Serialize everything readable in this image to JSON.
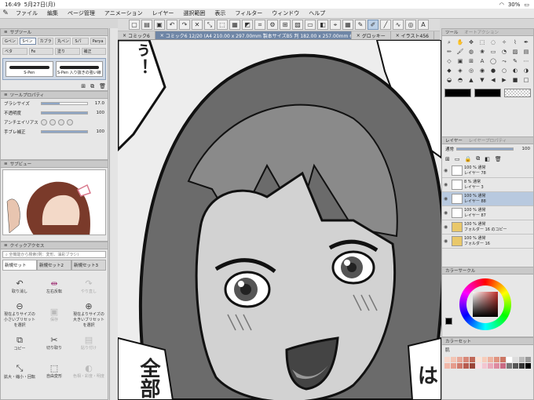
{
  "status": {
    "time": "16:49",
    "date": "5月27日(月)",
    "battery": "30%"
  },
  "menu": {
    "items": [
      "ファイル",
      "編集",
      "ページ管理",
      "アニメーション",
      "レイヤー",
      "選択範囲",
      "表示",
      "フィルター",
      "ウィンドウ",
      "ヘルプ"
    ]
  },
  "tabs": [
    {
      "label": "コミック6"
    },
    {
      "label": "コミック6 12/20 (A4 210.00 x 297.00mm 製本サイズB5 判 182.00 x 257.00mm 600dpi 119.9%)"
    },
    {
      "label": "グロッキー"
    },
    {
      "label": "イラスト456"
    }
  ],
  "subtool": {
    "title": "サブツール",
    "brushes": [
      "Gペン",
      "Sペン",
      "カブラ",
      "丸ペン",
      "Sパ",
      "Parya",
      "べタ",
      "Fe",
      "塗り",
      "補正"
    ],
    "selected_a": "S-Pen",
    "selected_b": "S-Pen 入り抜きの強い線"
  },
  "toolprop": {
    "title": "ツールプロパティ",
    "rows": [
      {
        "label": "ブラシサイズ",
        "value": "17.0"
      },
      {
        "label": "不透明度",
        "value": "100"
      },
      {
        "label": "アンチエイリアス",
        "value": ""
      },
      {
        "label": "手ブレ補正",
        "value": "100"
      }
    ]
  },
  "subview": {
    "title": "サブビュー"
  },
  "quick": {
    "title": "クイックアクセス",
    "search": "全機能から検索(例：変形、油彩ブラシ)",
    "tabs": [
      "新規セット",
      "新規セット2",
      "新規セット3"
    ],
    "cells": [
      {
        "label": "取り消し",
        "icon": "↶"
      },
      {
        "label": "左右反転",
        "icon": "⇹"
      },
      {
        "label": "やり直し",
        "icon": "↷"
      },
      {
        "label": "現在よりサイズの小さいブリセットを選択",
        "icon": "⊖"
      },
      {
        "label": "保存",
        "icon": "▣"
      },
      {
        "label": "現在よりサイズの大きいブリセットを選択",
        "icon": "⊕"
      },
      {
        "label": "コピー",
        "icon": "⧉"
      },
      {
        "label": "切り取り",
        "icon": "✂"
      },
      {
        "label": "貼り付け",
        "icon": "▤"
      },
      {
        "label": "拡大・縮小・回転",
        "icon": "⤡"
      },
      {
        "label": "自由変形",
        "icon": "⬚"
      },
      {
        "label": "色相・彩度・明度",
        "icon": "◐"
      }
    ]
  },
  "tools_panel": {
    "title": "ツール",
    "sub": "オートアクション"
  },
  "layers": {
    "title": "レイヤー",
    "sub": "レイヤープロパティ",
    "blend": "通常",
    "opacity": "100",
    "rows": [
      {
        "name": "100 % 通常\nレイヤー 78"
      },
      {
        "name": "8 % 通常\nレイヤー 3"
      },
      {
        "name": "100 % 通常\nレイヤー 88"
      },
      {
        "name": "100 % 通常\nレイヤー 87"
      },
      {
        "name": "100 % 通常\nフォルダー 16 のコピー"
      },
      {
        "name": "100 % 通常\nフォルダー 16"
      }
    ]
  },
  "color": {
    "title": "カラーサークル",
    "set_title": "カラーセット",
    "set_name": "肌"
  },
  "canvas": {
    "text_left": "全部",
    "text_top": "ぅ！",
    "text_right": "は"
  }
}
